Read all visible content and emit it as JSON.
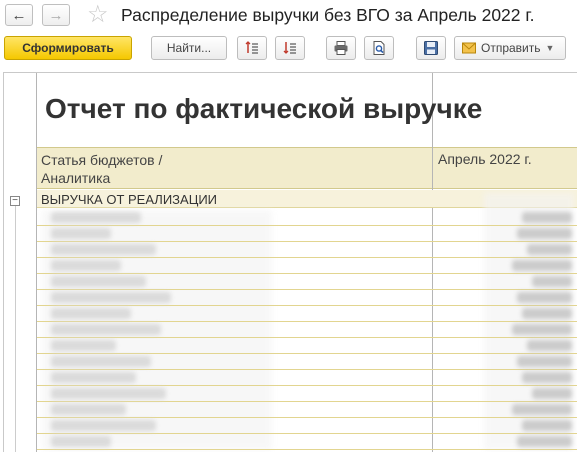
{
  "window": {
    "title": "Распределение выручки без ВГО  за Апрель 2022 г."
  },
  "toolbar": {
    "generate_label": "Сформировать",
    "find_label": "Найти...",
    "send_label": "Отправить"
  },
  "report": {
    "title": "Отчет по фактической выручке",
    "col1_header_line1": "Статья бюджетов /",
    "col1_header_line2": "Аналитика",
    "col2_header": "Апрель 2022 г.",
    "group_label": "ВЫРУЧКА ОТ РЕАЛИЗАЦИИ",
    "rows": [
      {
        "name_w": 90,
        "val_w": 50
      },
      {
        "name_w": 60,
        "val_w": 55
      },
      {
        "name_w": 105,
        "val_w": 45
      },
      {
        "name_w": 70,
        "val_w": 60
      },
      {
        "name_w": 95,
        "val_w": 40
      },
      {
        "name_w": 120,
        "val_w": 55
      },
      {
        "name_w": 80,
        "val_w": 50
      },
      {
        "name_w": 110,
        "val_w": 60
      },
      {
        "name_w": 65,
        "val_w": 45
      },
      {
        "name_w": 100,
        "val_w": 55
      },
      {
        "name_w": 85,
        "val_w": 50
      },
      {
        "name_w": 115,
        "val_w": 40
      },
      {
        "name_w": 75,
        "val_w": 60
      },
      {
        "name_w": 105,
        "val_w": 50
      },
      {
        "name_w": 60,
        "val_w": 55
      }
    ]
  }
}
